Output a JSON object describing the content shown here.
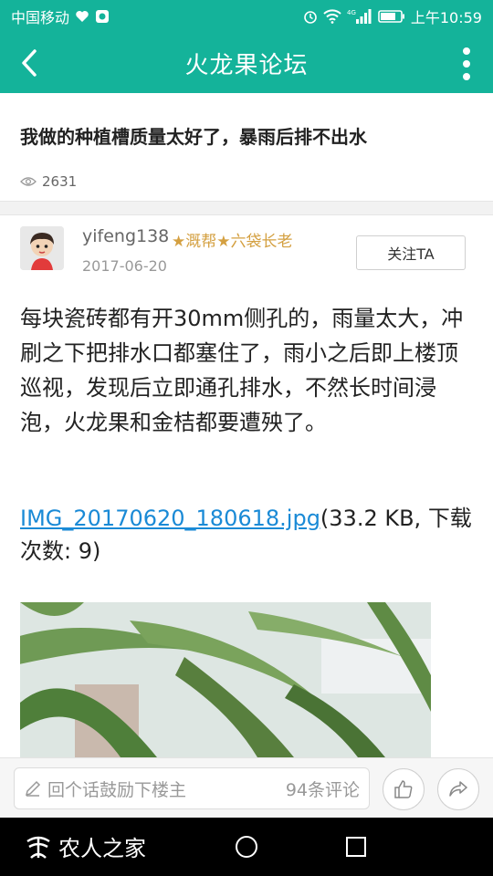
{
  "status_bar": {
    "carrier": "中国移动",
    "time": "上午10:59",
    "network": "4G"
  },
  "app_bar": {
    "title": "火龙果论坛",
    "back_icon": "chevron-left-icon",
    "more_icon": "more-vertical-icon"
  },
  "post": {
    "title": "我做的种植槽质量太好了，暴雨后排不出水",
    "views": "2631"
  },
  "author": {
    "name": "yifeng138",
    "badge": "★溉帮★六袋长老",
    "date": "2017-06-20",
    "follow_label": "关注TA"
  },
  "content": {
    "body": "  每块瓷砖都有开30mm侧孔的，雨量太大，冲刷之下把排水口都塞住了，雨小之后即上楼顶巡视，发现后立即通孔排水，不然长时间浸泡，火龙果和金桔都要遭殃了。",
    "attachment_name": "IMG_20170620_180618.jpg",
    "attachment_meta": "(33.2 KB, 下载次数: 9)"
  },
  "comment_bar": {
    "placeholder": "回个话鼓励下楼主",
    "count": "94条评论"
  },
  "nav_bar": {
    "brand": "农人之家"
  },
  "colors": {
    "accent": "#14b39a",
    "link": "#1a8ad6",
    "badge": "#d4a041"
  }
}
